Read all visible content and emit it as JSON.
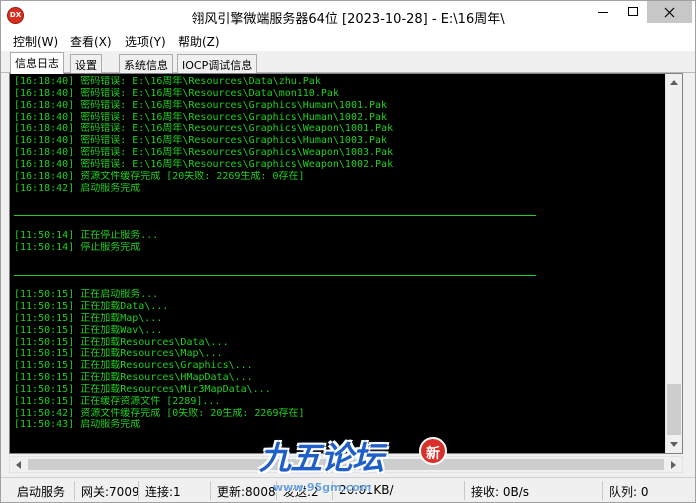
{
  "window": {
    "title": "翎风引擎微端服务器64位 [2023-10-28] - E:\\16周年\\",
    "icon_text": "DX"
  },
  "menu": {
    "items": [
      "控制(W)",
      "查看(X)",
      "选项(Y)",
      "帮助(Z)"
    ]
  },
  "tabs": [
    "信息日志",
    "设置",
    "系统信息",
    "IOCP调试信息"
  ],
  "log": {
    "color": "#20d020",
    "background": "#000000",
    "lines": [
      "[16:18:40] 密码错误: E:\\16周年\\Resources\\Data\\zhu.Pak",
      "[16:18:40] 密码错误: E:\\16周年\\Resources\\Data\\mon110.Pak",
      "[16:18:40] 密码错误: E:\\16周年\\Resources\\Graphics\\Human\\1001.Pak",
      "[16:18:40] 密码错误: E:\\16周年\\Resources\\Graphics\\Human\\1002.Pak",
      "[16:18:40] 密码错误: E:\\16周年\\Resources\\Graphics\\Weapon\\1001.Pak",
      "[16:18:40] 密码错误: E:\\16周年\\Resources\\Graphics\\Human\\1003.Pak",
      "[16:18:40] 密码错误: E:\\16周年\\Resources\\Graphics\\Weapon\\1003.Pak",
      "[16:18:40] 密码错误: E:\\16周年\\Resources\\Graphics\\Weapon\\1002.Pak",
      "[16:18:40] 资源文件缓存完成 [20失败: 2269生成: 0存在]",
      "[16:18:42] 启动服务完成",
      "",
      "",
      "",
      "[11:50:14] 正在停止服务...",
      "[11:50:14] 停止服务完成",
      "",
      "",
      "",
      "[11:50:15] 正在启动服务...",
      "[11:50:15] 正在加载Data\\...",
      "[11:50:15] 正在加载Map\\...",
      "[11:50:15] 正在加载Wav\\...",
      "[11:50:15] 正在加载Resources\\Data\\...",
      "[11:50:15] 正在加载Resources\\Map\\...",
      "[11:50:15] 正在加载Resources\\Graphics\\...",
      "[11:50:15] 正在加载Resources\\HMapData\\...",
      "[11:50:15] 正在加载Resources\\Mir3MapData\\...",
      "[11:50:15] 正在缓存资源文件 [2289]...",
      "[11:50:42] 资源文件缓存完成 [0失败: 20生成: 2269存在]",
      "[11:50:43] 启动服务完成"
    ]
  },
  "status": {
    "service": "启动服务",
    "gateway": "网关:7009",
    "connections": "连接:1",
    "update": "更新:8008",
    "send_partial": "发送:2",
    "rate_partial": "20.61KB/",
    "receive": "接收: 0B/s",
    "queue": "队列: 0"
  },
  "watermark": {
    "text": "九五论坛",
    "url": "www.95gm.com",
    "seal": "新"
  }
}
